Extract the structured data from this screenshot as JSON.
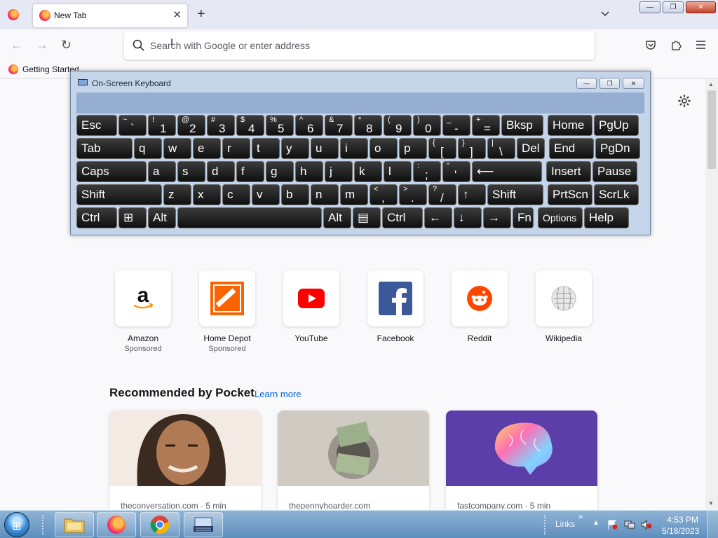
{
  "browser": {
    "tab_title": "New Tab",
    "url_placeholder": "Search with Google or enter address",
    "bookmark": "Getting Started"
  },
  "keyboard": {
    "title": "On-Screen Keyboard",
    "rows": [
      [
        {
          "t": "Esc"
        },
        {
          "s": "~",
          "b": "`"
        },
        {
          "s": "!",
          "b": "1"
        },
        {
          "s": "@",
          "b": "2"
        },
        {
          "s": "#",
          "b": "3"
        },
        {
          "s": "$",
          "b": "4"
        },
        {
          "s": "%",
          "b": "5"
        },
        {
          "s": "^",
          "b": "6"
        },
        {
          "s": "&",
          "b": "7"
        },
        {
          "s": "*",
          "b": "8"
        },
        {
          "s": "(",
          "b": "9"
        },
        {
          "s": ")",
          "b": "0"
        },
        {
          "s": "_",
          "b": "-"
        },
        {
          "s": "+",
          "b": "="
        },
        {
          "t": "Bksp"
        },
        {
          "t": "Home"
        },
        {
          "t": "PgUp"
        }
      ],
      [
        {
          "t": "Tab"
        },
        {
          "t": "q"
        },
        {
          "t": "w"
        },
        {
          "t": "e"
        },
        {
          "t": "r"
        },
        {
          "t": "t"
        },
        {
          "t": "y"
        },
        {
          "t": "u"
        },
        {
          "t": "i"
        },
        {
          "t": "o"
        },
        {
          "t": "p"
        },
        {
          "s": "{",
          "b": "["
        },
        {
          "s": "}",
          "b": "]"
        },
        {
          "s": "|",
          "b": "\\"
        },
        {
          "t": "Del"
        },
        {
          "t": "End"
        },
        {
          "t": "PgDn"
        }
      ],
      [
        {
          "t": "Caps"
        },
        {
          "t": "a"
        },
        {
          "t": "s"
        },
        {
          "t": "d"
        },
        {
          "t": "f"
        },
        {
          "t": "g"
        },
        {
          "t": "h"
        },
        {
          "t": "j"
        },
        {
          "t": "k"
        },
        {
          "t": "l"
        },
        {
          "s": ":",
          "b": ";"
        },
        {
          "s": "\"",
          "b": "'"
        },
        {
          "t": "⟵"
        },
        {
          "t": "Insert"
        },
        {
          "t": "Pause"
        }
      ],
      [
        {
          "t": "Shift"
        },
        {
          "t": "z"
        },
        {
          "t": "x"
        },
        {
          "t": "c"
        },
        {
          "t": "v"
        },
        {
          "t": "b"
        },
        {
          "t": "n"
        },
        {
          "t": "m"
        },
        {
          "s": "<",
          "b": ","
        },
        {
          "s": ">",
          "b": "."
        },
        {
          "s": "?",
          "b": "/"
        },
        {
          "t": "↑"
        },
        {
          "t": "Shift"
        },
        {
          "t": "PrtScn"
        },
        {
          "t": "ScrLk"
        }
      ],
      [
        {
          "t": "Ctrl"
        },
        {
          "t": "⊞"
        },
        {
          "t": "Alt"
        },
        {
          "t": ""
        },
        {
          "t": "Alt"
        },
        {
          "t": "▤"
        },
        {
          "t": "Ctrl"
        },
        {
          "t": "←"
        },
        {
          "t": "↓"
        },
        {
          "t": "→"
        },
        {
          "t": "Fn"
        },
        {
          "t": "Options"
        },
        {
          "t": "Help"
        }
      ]
    ]
  },
  "shortcuts": [
    {
      "label": "Amazon",
      "sub": "Sponsored",
      "icon": "amazon-icon"
    },
    {
      "label": "Home Depot",
      "sub": "Sponsored",
      "icon": "home-depot-icon"
    },
    {
      "label": "YouTube",
      "sub": "",
      "icon": "youtube-icon"
    },
    {
      "label": "Facebook",
      "sub": "",
      "icon": "facebook-icon"
    },
    {
      "label": "Reddit",
      "sub": "",
      "icon": "reddit-icon"
    },
    {
      "label": "Wikipedia",
      "sub": "",
      "icon": "wikipedia-icon"
    }
  ],
  "pocket": {
    "title": "Recommended by Pocket",
    "learn_more": "Learn more",
    "cards": [
      {
        "source": "theconversation.com · 5 min"
      },
      {
        "source": "thepennyhoarder.com"
      },
      {
        "source": "fastcompany.com · 5 min"
      }
    ]
  },
  "taskbar": {
    "links": "Links",
    "time": "4:53 PM",
    "date": "5/18/2023"
  },
  "colors": {
    "accent_link": "#0061e0",
    "osk_background": "#c4d5ea",
    "key_background": "#1f1f1f"
  }
}
